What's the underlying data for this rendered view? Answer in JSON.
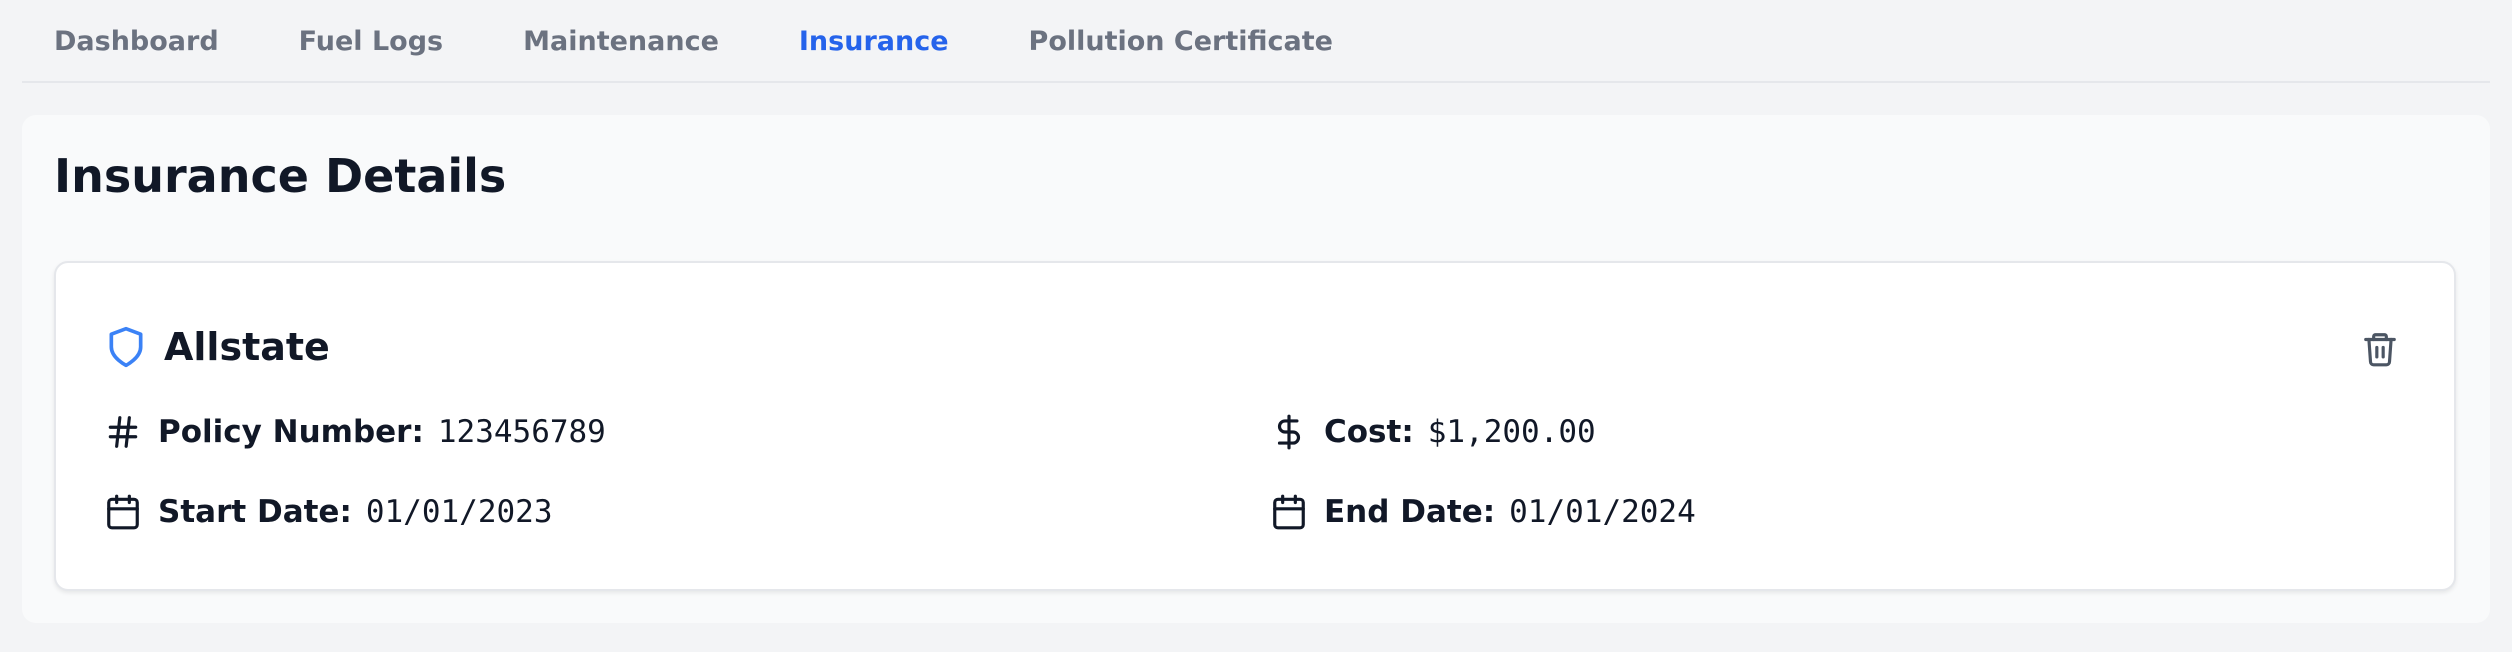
{
  "tabs": [
    {
      "label": "Dashboard",
      "active": false
    },
    {
      "label": "Fuel Logs",
      "active": false
    },
    {
      "label": "Maintenance",
      "active": false
    },
    {
      "label": "Insurance",
      "active": true
    },
    {
      "label": "Pollution Certificate",
      "active": false
    }
  ],
  "panel": {
    "title": "Insurance Details"
  },
  "insurance": {
    "provider": "Allstate",
    "provider_icon": "shield-icon",
    "delete_icon": "trash-icon",
    "policy_number_label": "Policy Number:",
    "policy_number": "123456789",
    "cost_label": "Cost:",
    "cost": "$1,200.00",
    "start_date_label": "Start Date:",
    "start_date": "01/01/2023",
    "end_date_label": "End Date:",
    "end_date": "01/01/2024"
  },
  "colors": {
    "accent": "#2563eb",
    "tab_inactive": "#6b7280",
    "text": "#111827",
    "page_bg": "#f3f4f6"
  }
}
